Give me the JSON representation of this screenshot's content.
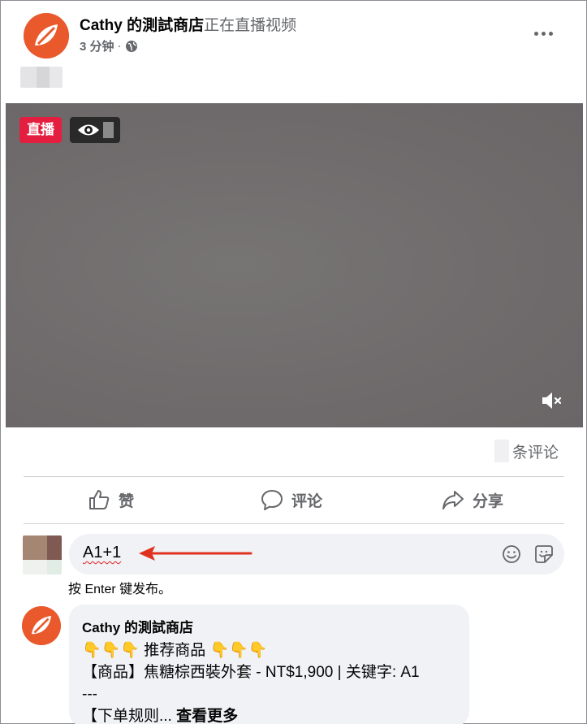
{
  "post": {
    "page_name": "Cathy 的測試商店",
    "status_text": "正在直播视频",
    "time": "3 分钟",
    "separator": "·",
    "privacy_icon": "globe-icon"
  },
  "video": {
    "live_label": "直播",
    "viewer_icon": "eye-icon",
    "sound_icon": "speaker-muted-icon"
  },
  "stats": {
    "comments_label": "条评论"
  },
  "actions": {
    "like_label": "赞",
    "comment_label": "评论",
    "share_label": "分享"
  },
  "composer": {
    "value": "A1+1",
    "hint": "按 Enter 键发布。",
    "emoji_icon": "smiley-icon",
    "sticker_icon": "sticker-icon"
  },
  "comment": {
    "author": "Cathy 的測試商店",
    "line1_emoji": "👇👇👇",
    "line1_text": " 推荐商品 ",
    "line1_emoji_after": "👇👇👇",
    "line2": "【商品】焦糖棕西裝外套 - NT$1,900 | 关键字: A1",
    "line3": "---",
    "line4_text": "【下单规则... ",
    "see_more": "查看更多"
  },
  "colors": {
    "live_red": "#e41e3f",
    "brand_orange": "#e9592b",
    "annotation_arrow": "#e0321e",
    "secondary_text": "#65676b"
  }
}
